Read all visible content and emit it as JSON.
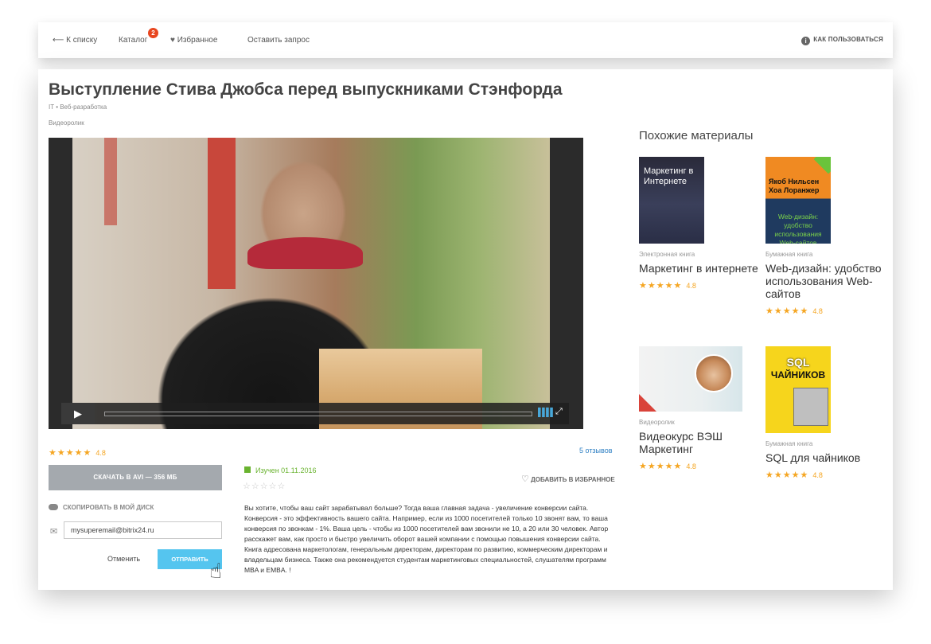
{
  "nav": {
    "back": "⟵ К списку",
    "catalog": "Каталог",
    "catalog_badge": "2",
    "favorites": "Избранное",
    "request": "Оставить запрос",
    "howto": "КАК ПОЛЬЗОВАТЬСЯ"
  },
  "material": {
    "title": "Выступление Стива Джобса перед выпускниками Стэнфорда",
    "breadcrumbs": "IT • Веб-разработка",
    "type": "Видеоролик",
    "rating": "4.8",
    "reviews": "5 отзывов",
    "download": "СКАЧАТЬ В AVI — 356 МБ",
    "copy_to_disk": "СКОПИРОВАТЬ В МОЙ ДИСК",
    "email_value": "mysuperemail@bitrix24.ru",
    "cancel": "Отменить",
    "send": "ОТПРАВИТЬ",
    "studied": "Изучен 01.11.2016",
    "add_favorite": "ДОБАВИТЬ В ИЗБРАННОЕ",
    "description": "Вы хотите, чтобы ваш сайт зарабатывал больше? Тогда ваша главная задача - увеличение конверсии сайта. Конверсия - это эффективность вашего сайта. Например, если из 1000 посетителей только 10 звонят вам, то ваша конверсия по звонкам - 1%. Ваша цель - чтобы из 1000 посетителей вам звонили не 10, а 20 или 30 человек. Автор расскажет вам, как просто и быстро увеличить оборот вашей компании с помощью повышения конверсии сайта. Книга адресована маркетологам, генеральным директорам, директорам по развитию, коммерческим директорам и владельцам бизнеса. Также она рекомендуется студентам маркетинговых специальностей, слушателям программ MBA и EMBA. !"
  },
  "similar": {
    "title": "Похожие материалы",
    "items": [
      {
        "type": "Электронная книга",
        "name": "Маркетинг в интернете",
        "rating": "4.8",
        "cover": "Маркетинг в Интернете"
      },
      {
        "type": "Бумажная книга",
        "name": "Web-дизайн: удобство использования Web-сайтов",
        "rating": "4.8",
        "cover_top": "Якоб Нильсен Хоа Лоранжер",
        "cover_bottom": "Web-дизайн: удобство использования Web-сайтов"
      },
      {
        "type": "Видеоролик",
        "name": "Видеокурс ВЭШ Маркетинг",
        "rating": "4.8"
      },
      {
        "type": "Бумажная книга",
        "name": "SQL для чайников",
        "rating": "4.8",
        "cover_top": "SQL",
        "cover_bottom": "ЧАЙНИКОВ"
      }
    ]
  },
  "colors": {
    "accent": "#55c5ef",
    "star": "#f5a623",
    "badge": "#e8461f",
    "link": "#2f80c4",
    "success": "#69b32f"
  }
}
